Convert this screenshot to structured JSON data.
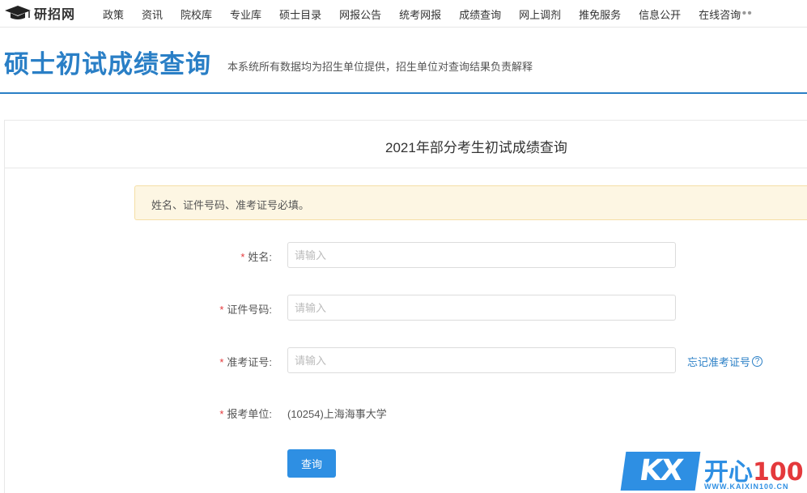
{
  "logo": {
    "text": "研招网",
    "icon": "graduation-cap-icon"
  },
  "nav": {
    "items": [
      "政策",
      "资讯",
      "院校库",
      "专业库",
      "硕士目录",
      "网报公告",
      "统考网报",
      "成绩查询",
      "网上调剂",
      "推免服务",
      "信息公开",
      "在线咨询"
    ],
    "more": "•••"
  },
  "header": {
    "title": "硕士初试成绩查询",
    "subtitle": "本系统所有数据均为招生单位提供，招生单位对查询结果负责解释"
  },
  "panel": {
    "title": "2021年部分考生初试成绩查询",
    "alert": "姓名、证件号码、准考证号必填。"
  },
  "form": {
    "required_mark": "*",
    "name": {
      "label": "姓名:",
      "placeholder": "请输入",
      "value": ""
    },
    "id_number": {
      "label": "证件号码:",
      "placeholder": "请输入",
      "value": ""
    },
    "exam_number": {
      "label": "准考证号:",
      "placeholder": "请输入",
      "value": "",
      "forgot_link": "忘记准考证号",
      "help_icon": "?"
    },
    "unit": {
      "label": "报考单位:",
      "value": "(10254)上海海事大学"
    },
    "submit_label": "查询"
  },
  "watermark": {
    "box_text": "KX",
    "brand": "开心",
    "brand_num": "100",
    "url": "WWW.KAIXIN100.CN"
  },
  "colors": {
    "accent": "#2a7fc6",
    "button": "#2e8fe3",
    "required": "#e4393c",
    "alert_bg": "#fdf6e3"
  }
}
